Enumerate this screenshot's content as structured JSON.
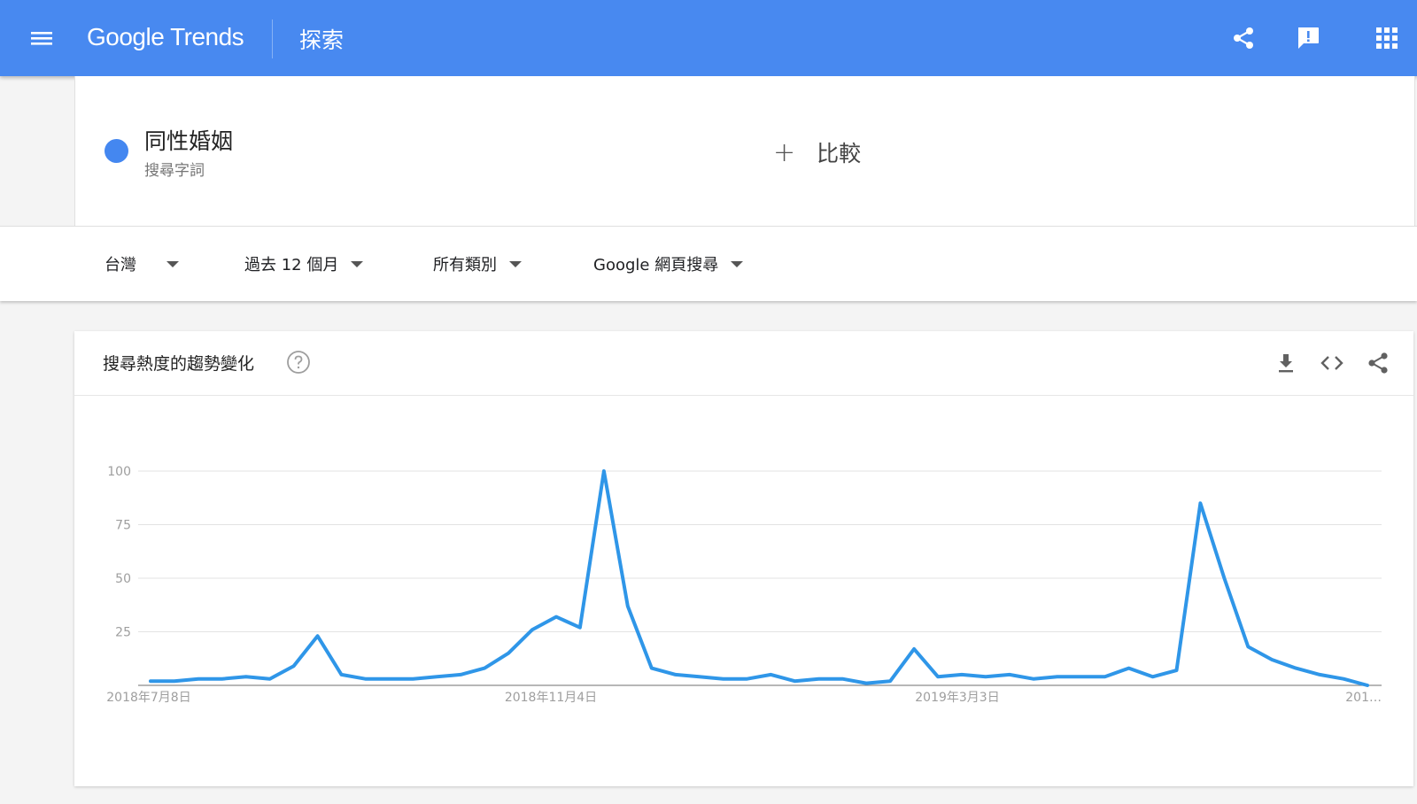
{
  "header": {
    "brand": "Google Trends",
    "page_title": "探索",
    "icons": [
      "menu-icon",
      "share-icon",
      "feedback-icon",
      "apps-icon"
    ],
    "bar_color": "#4889f0"
  },
  "search_term": {
    "name": "同性婚姻",
    "type_label": "搜尋字詞",
    "dot_color": "#4487f0"
  },
  "compare": {
    "label": "比較"
  },
  "filters": {
    "region": "台灣",
    "time_range": "過去 12 個月",
    "category": "所有類別",
    "search_type": "Google 網頁搜尋"
  },
  "chart_card": {
    "title": "搜尋熱度的趨勢變化",
    "icons": [
      "help-icon",
      "download-icon",
      "embed-icon",
      "share-icon"
    ]
  },
  "chart_data": {
    "type": "line",
    "title": "搜尋熱度的趨勢變化",
    "xlabel": "",
    "ylabel": "",
    "ylim": [
      0,
      100
    ],
    "yticks": [
      0,
      25,
      50,
      75,
      100
    ],
    "ytick_labels": [
      "100",
      "75",
      "50",
      "25"
    ],
    "xtick_labels": [
      "2018年7月8日",
      "2018年11月4日",
      "2019年3月3日",
      "201…"
    ],
    "grid": true,
    "line_color": "#2f96e8",
    "series": [
      {
        "values": [
          2,
          2,
          3,
          3,
          4,
          3,
          9,
          23,
          5,
          3,
          3,
          3,
          4,
          5,
          8,
          15,
          26,
          32,
          27,
          100,
          37,
          8,
          5,
          4,
          3,
          3,
          5,
          2,
          3,
          3,
          1,
          2,
          17,
          4,
          5,
          4,
          5,
          3,
          4,
          4,
          4,
          8,
          4,
          7,
          85,
          50,
          18,
          12,
          8,
          5,
          3,
          0
        ]
      }
    ]
  }
}
